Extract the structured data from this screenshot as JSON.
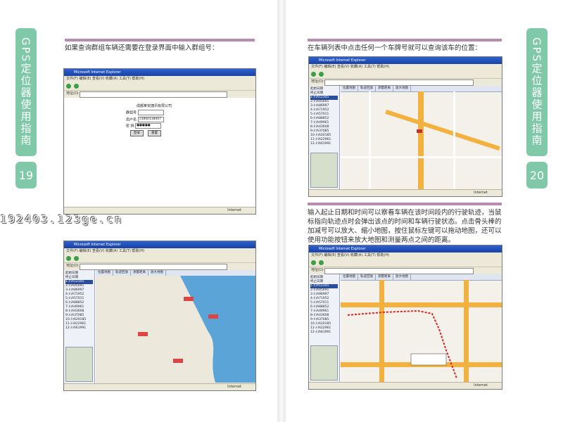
{
  "side_tab": {
    "title": "GPS定位器使用指南"
  },
  "page_numbers": {
    "left": "19",
    "right": "20"
  },
  "captions": {
    "top_left": "如果查询群组车辆还需要在登录界面中输入群组号：",
    "top_right": "在车辆列表中点击任何一个车牌号就可以查询该车的位置：",
    "bottom_right": "输入起止日期和时间可以察看车辆在该时间段内的行驶轨迹，当鼠标指向轨迹点时会弹出该点的时间和车辆行驶状态。点击骨头棒的加减号可以放大、缩小地图，按住鼠标左键可以拖动地图，还可以使用功能按钮来放大地图和测量两点之间的距离。"
  },
  "watermark": "192403.123ge.cn",
  "browser": {
    "title": "Microsoft Internet Explorer",
    "menu": "文件(F)  编辑(E)  查看(V)  收藏(A)  工具(T)  帮助(H)",
    "address_label": "地址(D)",
    "status_zone": "Internet"
  },
  "login": {
    "company": "成都某安捷讯有限公司",
    "group_label": "群组号",
    "user_label": "用户名",
    "user_value": "13800138007",
    "password_label": "密 码",
    "password_value": "●●●●●",
    "login_button": "登录",
    "reset_button": "重置"
  },
  "map_tabs": [
    "位置地图",
    "轨迹回放",
    "测量距离",
    "放大地图"
  ],
  "vehicle_list": [
    "1-川A12345",
    "2-川A45691",
    "3-川A86997",
    "4-川A71952",
    "5-川A57011",
    "6-川A88852",
    "7-川A49961",
    "8-川A43608",
    "9-川A37085",
    "10-川A20185",
    "11-川A22961",
    "12-川A61991"
  ],
  "side_labels": {
    "start": "起始日期",
    "end": "终止日期",
    "time": "时间"
  }
}
